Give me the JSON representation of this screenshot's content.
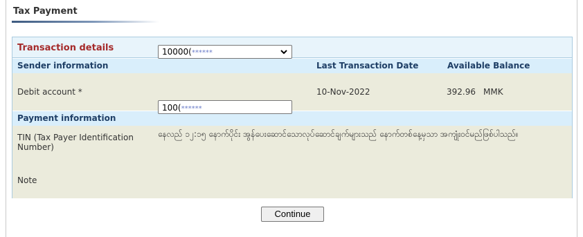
{
  "page": {
    "title": "Tax Payment"
  },
  "panel": {
    "title": "Transaction details",
    "sender": {
      "heading": "Sender information",
      "last_date_heading": "Last Transaction Date",
      "balance_heading": "Available Balance",
      "debit_label": "Debit account *",
      "debit_value": "10000(",
      "debit_mask": "******",
      "last_date": "10-Nov-2022",
      "balance_amount": "392.96",
      "balance_currency": "MMK"
    },
    "payment": {
      "heading": "Payment information",
      "tin_label_1": "TIN (Tax Payer Identification",
      "tin_label_2": "Number)",
      "tin_value": "100(",
      "tin_mask": "******",
      "note_label": "Note",
      "note_text": "နေလည် ၁၂:၁၅ နောက်ပိုင်း အွန်ပေးဆောင်သောလုပ်ဆောင်ချက်များသည် နောက်တစ်နေ့မှသာ အကျုံးဝင်မည်ဖြစ်ပါသည်။"
    }
  },
  "actions": {
    "continue_label": "Continue"
  },
  "icons": {
    "select_arrow": "chevron-down-icon"
  }
}
